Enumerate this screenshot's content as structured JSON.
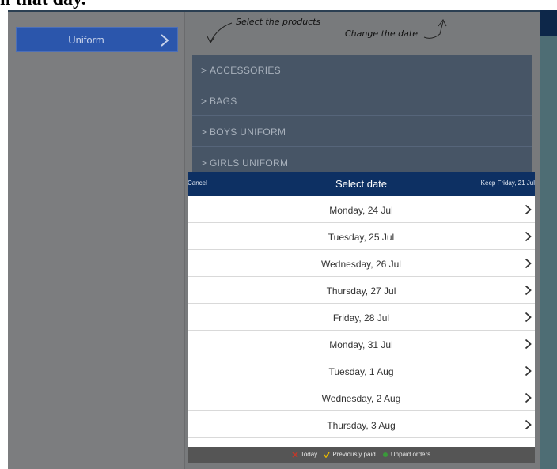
{
  "page": {
    "cropped_heading": "n that day."
  },
  "sidebar": {
    "uniform_label": "Uniform"
  },
  "annotations": {
    "select_products": "Select the products",
    "change_date": "Change the date"
  },
  "categories": [
    {
      "label": "ACCESSORIES"
    },
    {
      "label": "BAGS"
    },
    {
      "label": "BOYS UNIFORM"
    },
    {
      "label": "GIRLS UNIFORM"
    }
  ],
  "date_picker": {
    "cancel_label": "Cancel",
    "title": "Select date",
    "keep_label": "Keep Friday, 21 Jul",
    "dates": [
      "Monday, 24 Jul",
      "Tuesday, 25 Jul",
      "Wednesday, 26 Jul",
      "Thursday, 27 Jul",
      "Friday, 28 Jul",
      "Monday, 31 Jul",
      "Tuesday, 1 Aug",
      "Wednesday, 2 Aug",
      "Thursday, 3 Aug"
    ]
  },
  "legend": {
    "today": "Today",
    "previously_paid": "Previously paid",
    "unpaid_orders": "Unpaid orders"
  },
  "colors": {
    "header_navy": "#0d3063",
    "button_blue": "#2b56ac",
    "category_slate": "#475566",
    "today_red": "#c0392b",
    "paid_yellow": "#e6b800",
    "unpaid_green": "#3a9a3a"
  },
  "icons": {
    "chevron": "chevron-right-icon",
    "today": "x-icon",
    "paid": "check-icon",
    "unpaid": "dot-icon"
  }
}
